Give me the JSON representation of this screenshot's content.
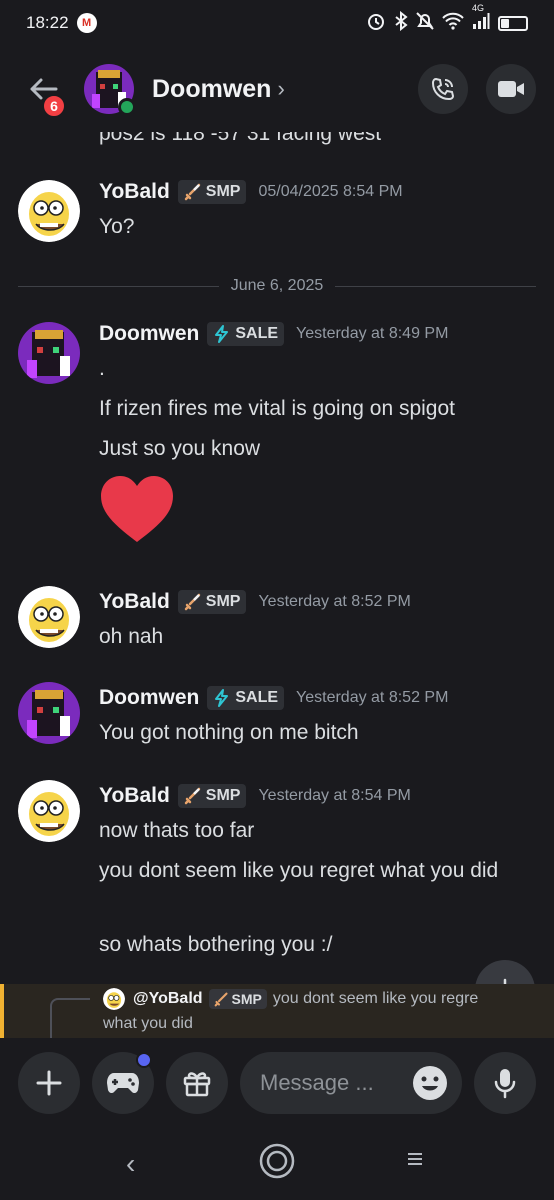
{
  "status_bar": {
    "time": "18:22",
    "gmail_letter": "M",
    "network": "4G"
  },
  "header": {
    "back_badge": "6",
    "title": "Doomwen",
    "chevron": "›",
    "icons": [
      "back-arrow-icon",
      "call-icon",
      "video-icon"
    ]
  },
  "conversation": {
    "cutoff_text": "pos2 is 118 -57 31 facing west",
    "date_divider": "June 6, 2025",
    "messages": [
      {
        "author": "YoBald",
        "tag": "SMP",
        "tag_icon": "sword-icon",
        "timestamp": "05/04/2025 8:54 PM",
        "lines": [
          "Yo?"
        ]
      },
      {
        "author": "Doomwen",
        "tag": "SALE",
        "tag_icon": "lightning-icon",
        "timestamp": "Yesterday at 8:49 PM",
        "lines": [
          ".",
          "If rizen fires me vital is going on spigot",
          "Just so you know"
        ],
        "emoji": "heart"
      },
      {
        "author": "YoBald",
        "tag": "SMP",
        "tag_icon": "sword-icon",
        "timestamp": "Yesterday at 8:52 PM",
        "lines": [
          "oh nah"
        ]
      },
      {
        "author": "Doomwen",
        "tag": "SALE",
        "tag_icon": "lightning-icon",
        "timestamp": "Yesterday at 8:52 PM",
        "lines": [
          "You got nothing on me bitch"
        ]
      },
      {
        "author": "YoBald",
        "tag": "SMP",
        "tag_icon": "sword-icon",
        "timestamp": "Yesterday at 8:54 PM",
        "lines": [
          "now thats too far",
          "you dont seem like you regret what you did",
          "so whats bothering you :/"
        ]
      }
    ]
  },
  "reply_preview": {
    "mention": "@YoBald",
    "tag": "SMP",
    "text_line1": "you dont seem like you regre",
    "text_line2": "what you did"
  },
  "composer": {
    "placeholder": "Message ...",
    "icons": [
      "plus-icon",
      "gamepad-icon",
      "gift-icon",
      "emoji-icon",
      "microphone-icon"
    ]
  },
  "nav": {
    "back": "‹",
    "icons": [
      "nav-back-icon",
      "nav-home-icon",
      "nav-menu-icon"
    ]
  },
  "colors": {
    "background": "#1a1a1e",
    "badge_red": "#f23f43",
    "online_green": "#23a55a",
    "heart_red": "#e8394a",
    "reply_highlight": "#f0b232",
    "notification_blue": "#5865f2"
  }
}
